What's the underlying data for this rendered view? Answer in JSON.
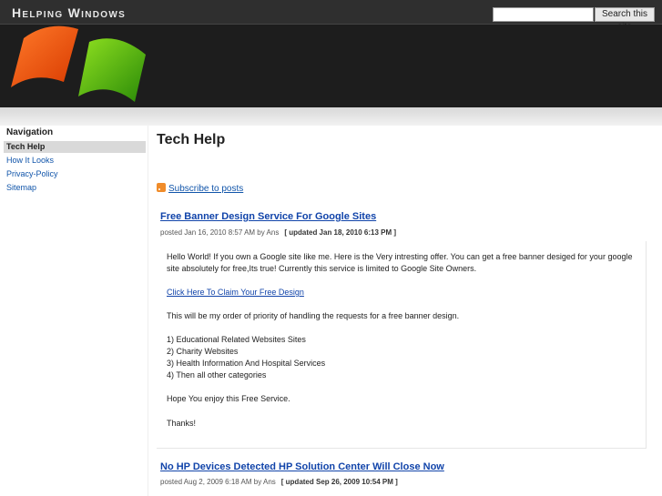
{
  "header": {
    "site_title": "Helping Windows",
    "search_placeholder": "",
    "search_button": "Search this site"
  },
  "sidebar": {
    "heading": "Navigation",
    "items": [
      {
        "label": "Tech Help",
        "active": true
      },
      {
        "label": "How It Looks",
        "active": false
      },
      {
        "label": "Privacy-Policy",
        "active": false
      },
      {
        "label": "Sitemap",
        "active": false
      }
    ]
  },
  "main": {
    "page_title": "Tech Help",
    "subscribe_label": "Subscribe to posts"
  },
  "posts": [
    {
      "title": "Free Banner Design Service For Google Sites",
      "meta": "posted Jan 16, 2010 8:57 AM by Ans",
      "updated": "[ updated Jan 18, 2010 6:13 PM ]",
      "paragraphs": [
        "Hello World! If you own a Google site like me. Here is the Very intresting offer. You can get a free banner desiged for your google site absolutely for free,Its true! Currently this service is limited to Google Site Owners.",
        "Click Here To Claim Your Free Design",
        "This will be my order of priority of handling the requests for a free banner design.",
        "1) Educational Related Websites Sites",
        "2) Charity Websites",
        "3) Health Information And Hospital Services",
        "4) Then all other categories",
        "Hope You enjoy this Free Service.",
        "Thanks!"
      ]
    },
    {
      "title": "No HP Devices Detected HP Solution Center Will Close Now",
      "meta": "posted Aug 2, 2009 6:18 AM by Ans",
      "updated": "[ updated Sep 26, 2009 10:54 PM ]"
    }
  ],
  "colors": {
    "topbar": "#2f2f2f",
    "banner": "#1d1d1d",
    "link": "#1144aa",
    "logo_orange": "#f05a10",
    "logo_green": "#4caf10"
  }
}
